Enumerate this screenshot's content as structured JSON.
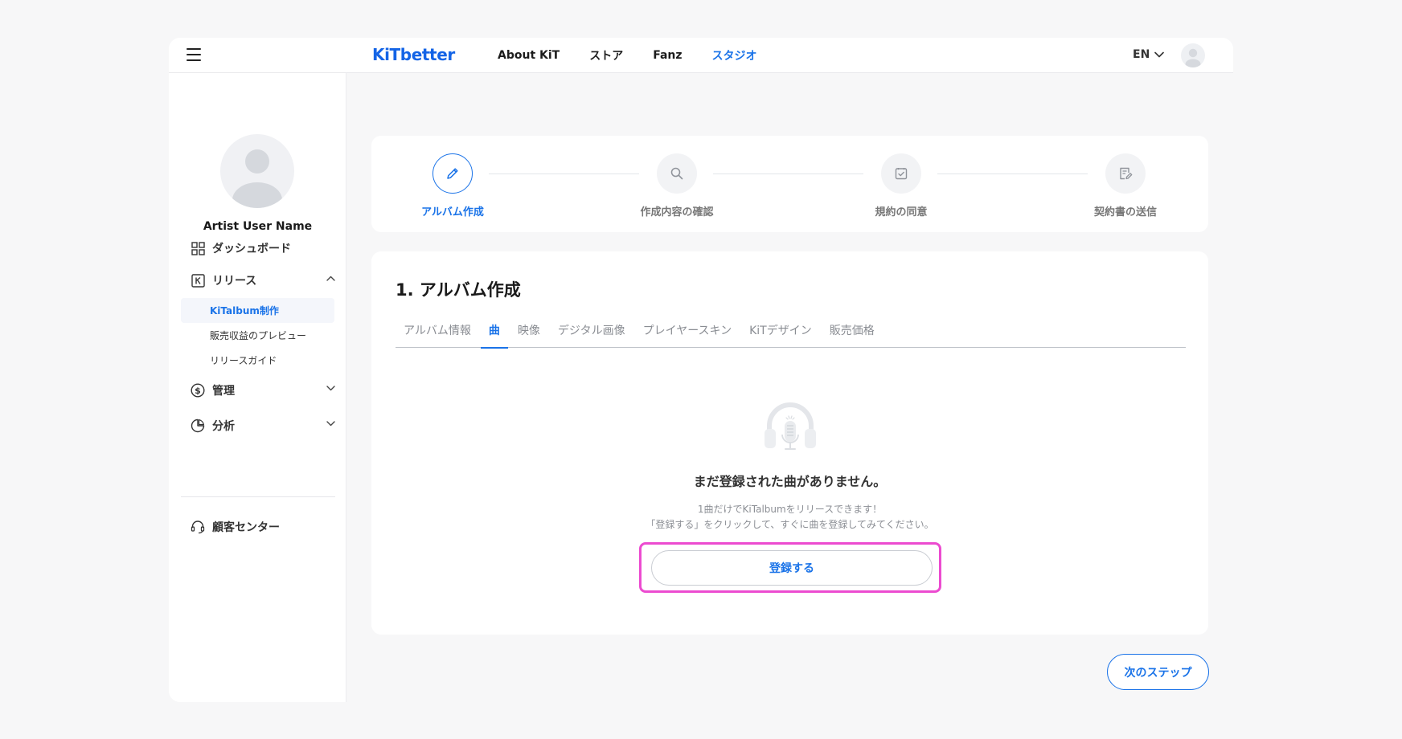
{
  "header": {
    "logo": "KiTbetter",
    "nav": [
      "About KiT",
      "ストア",
      "Fanz",
      "スタジオ"
    ],
    "nav_active_index": 3,
    "language": "EN"
  },
  "sidebar": {
    "user_name": "Artist User Name",
    "menu": {
      "dashboard": "ダッシュボード",
      "release": "リリース",
      "release_sub": [
        "KiTalbum制作",
        "販売収益のプレビュー",
        "リリースガイド"
      ],
      "manage": "管理",
      "analytics": "分析",
      "support": "顧客センター"
    }
  },
  "stepper": {
    "steps": [
      "アルバム作成",
      "作成内容の確認",
      "規約の同意",
      "契約書の送信"
    ],
    "active_index": 0
  },
  "content": {
    "title": "1. アルバム作成",
    "tabs": [
      "アルバム情報",
      "曲",
      "映像",
      "デジタル画像",
      "プレイヤースキン",
      "KiTデザイン",
      "販売価格"
    ],
    "active_tab_index": 1,
    "empty_title": "まだ登録された曲がありません。",
    "empty_desc_line1": "1曲だけでKiTalbumをリリースできます！",
    "empty_desc_line2": "「登録する」をクリックして、すぐに曲を登録してみてください。",
    "register_button": "登録する"
  },
  "footer": {
    "next_button": "次のステップ"
  },
  "colors": {
    "accent": "#1a73e8",
    "highlight": "#ec4bd0",
    "background": "#f7f7f8"
  }
}
